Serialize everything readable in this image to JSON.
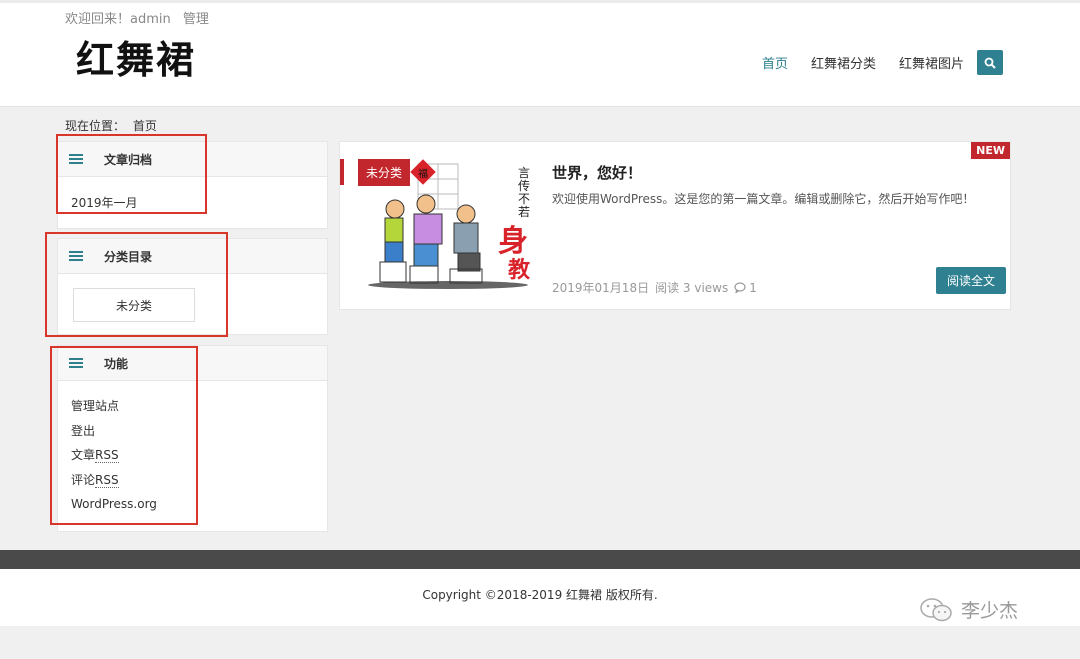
{
  "header": {
    "welcome": "欢迎回来！admin",
    "admin_link": "管理",
    "logo": "红舞裙",
    "nav": [
      "首页",
      "红舞裙分类",
      "红舞裙图片"
    ],
    "search_icon": "search-icon",
    "accent_color": "#2f8090"
  },
  "breadcrumb": {
    "label": "现在位置：",
    "current": "首页"
  },
  "sidebar": {
    "archive": {
      "title": "文章归档",
      "items": [
        "2019年一月"
      ]
    },
    "categories": {
      "title": "分类目录",
      "items": [
        "未分类"
      ]
    },
    "functions": {
      "title": "功能",
      "items": [
        "管理站点",
        "登出",
        "文章",
        "RSS",
        "评论",
        "RSS",
        "WordPress.org"
      ]
    }
  },
  "post": {
    "badge": "NEW",
    "category": "未分类",
    "title": "世界，您好！",
    "excerpt": "欢迎使用WordPress。这是您的第一篇文章。编辑或删除它，然后开始写作吧！",
    "date": "2019年01月18日",
    "reads": "阅读 3 views",
    "comments": "1",
    "read_more": "阅读全文",
    "thumb_text": {
      "line1": "言传不若",
      "line2": "身教",
      "seal": "福"
    }
  },
  "footer": {
    "copyright": "Copyright ©2018-2019  红舞裙  版权所有.",
    "watermark": "李少杰"
  }
}
